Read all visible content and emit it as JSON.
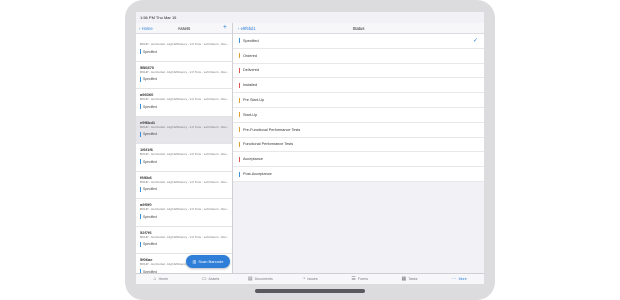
{
  "statusbar": {
    "time": "1:56 PM  Thu Mar 15",
    "battery": "95%"
  },
  "left": {
    "back_label": "Home",
    "title": "Assets",
    "add_icon": "plus-icon",
    "assets": [
      {
        "code": "",
        "desc": "BOHP - Horizontal - High Efficiency - 2.0 Tons - Left Return - Rev...",
        "status": "Specified",
        "color": "#3a8fd8"
      },
      {
        "code": "5B0870",
        "desc": "BOHP - Horizontal - High Efficiency - 2.0 Tons - Left Return - Rev...",
        "status": "Specified",
        "color": "#3a8fd8"
      },
      {
        "code": "a96060",
        "desc": "BOHP - Horizontal - High Efficiency - 2.0 Tons - Left Return - Rev...",
        "status": "Specified",
        "color": "#3a8fd8"
      },
      {
        "code": "e9f6bd1",
        "desc": "BOHP - Horizontal - High Efficiency - 2.0 Tons - Left Return - Rev...",
        "status": "Specified",
        "color": "#3a8fd8",
        "selected": true
      },
      {
        "code": "1f6f1f6",
        "desc": "BOHP - Horizontal - High Efficiency - 2.0 Tons - Left Return - Rev...",
        "status": "Specified",
        "color": "#3a8fd8"
      },
      {
        "code": "f6f6b6",
        "desc": "BOHP - Horizontal - High Efficiency - 2.0 Tons - Left Return - Rev...",
        "status": "Specified",
        "color": "#3a8fd8"
      },
      {
        "code": "a9f0f0",
        "desc": "BOHP - Horizontal - High Efficiency - 2.0 Tons - Left Return - Rev...",
        "status": "Specified",
        "color": "#3a8fd8"
      },
      {
        "code": "52f7f6",
        "desc": "BOHP - Horizontal - High Efficiency - 2.0 Tons - Left Return - Rev...",
        "status": "Specified",
        "color": "#3a8fd8"
      },
      {
        "code": "5f06ae",
        "desc": "BOHP - Horizontal - High Efficiency - 2.0 Tons - Left Return - Rev...",
        "status": "Specified",
        "color": "#3a8fd8"
      }
    ],
    "scan_label": "Scan Barcode"
  },
  "right": {
    "back_label": "e9f6bd1",
    "title": "Status",
    "statuses": [
      {
        "label": "Specified",
        "color": "#3a8fd8",
        "checked": true
      },
      {
        "label": "Ordered",
        "color": "#e0a030"
      },
      {
        "label": "Delivered",
        "color": "#e05050"
      },
      {
        "label": "Installed",
        "color": "#e05050"
      },
      {
        "label": "Pre Start-Up",
        "color": "#e0a030"
      },
      {
        "label": "Start-Up",
        "color": "#e0a030"
      },
      {
        "label": "Pre-Functional Performance Tests",
        "color": "#e0a030"
      },
      {
        "label": "Functional Performance Tests",
        "color": "#e0a030"
      },
      {
        "label": "Acceptance",
        "color": "#e05050"
      },
      {
        "label": "Post-Acceptance",
        "color": "#3a8fd8"
      }
    ]
  },
  "tabbar": [
    {
      "label": "Home",
      "icon": "home-icon",
      "glyph": "⌂"
    },
    {
      "label": "Assets",
      "icon": "assets-icon",
      "glyph": "▭"
    },
    {
      "label": "Documents",
      "icon": "documents-icon",
      "glyph": "▤"
    },
    {
      "label": "Issues",
      "icon": "issues-icon",
      "glyph": "◔"
    },
    {
      "label": "Forms",
      "icon": "forms-icon",
      "glyph": "☰"
    },
    {
      "label": "Tasks",
      "icon": "tasks-icon",
      "glyph": "▦"
    },
    {
      "label": "More",
      "icon": "more-icon",
      "glyph": "⋯",
      "active": true
    }
  ]
}
